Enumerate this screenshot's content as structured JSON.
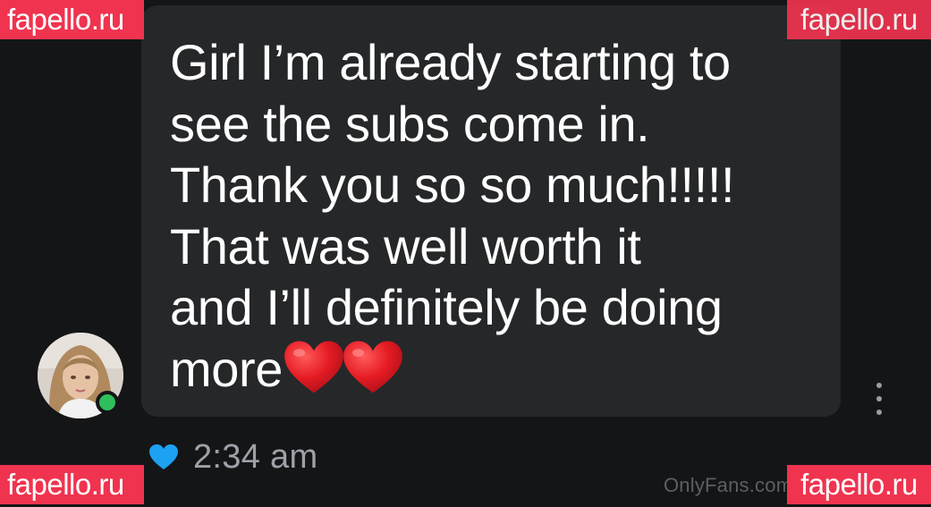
{
  "message": {
    "text": "Girl I’m already starting to\nsee the subs come in.\nThank you so so much!!!!!\nThat was well worth it\nand I’ll definitely be doing\nmore",
    "emoji": "❤️❤️"
  },
  "meta": {
    "timestamp": "2:34 am",
    "like_icon": "heart-icon",
    "like_color": "#1da1f2"
  },
  "avatar": {
    "status": "online",
    "status_color": "#2fbf5a"
  },
  "watermarks": {
    "top_left": "fapello.ru",
    "top_right": "fapello.ru",
    "bottom_left": "fapello.ru",
    "bottom_right": "fapello.ru",
    "source": "OnlyFans.com/"
  },
  "colors": {
    "background": "#141517",
    "bubble": "#252729",
    "watermark_bg": "#f0334f"
  }
}
